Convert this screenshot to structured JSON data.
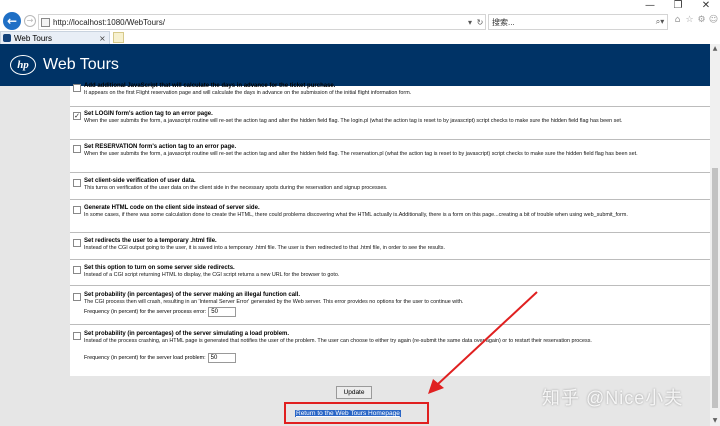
{
  "browser": {
    "url": "http://localhost:1080/WebTours/",
    "search_placeholder": "搜索...",
    "tab_title": "Web Tours",
    "window_controls": [
      "—",
      "❐",
      "✕"
    ]
  },
  "header": {
    "logo_text": "hp",
    "brand": "Web Tours"
  },
  "options": [
    {
      "checked": false,
      "title": "Add additional JavaScript that will calculate the days in advance for the ticket purchase.",
      "desc": "It appears on the first Flight reservation page and will calculate the days in advance on the submission of the initial flight information form."
    },
    {
      "checked": true,
      "title": "Set LOGIN form's action tag to an error page.",
      "desc": "When the user submits the form, a javascript routine will re-set the action tag and alter the hidden field flag. The login.pl (what the action tag is reset to by javascript) script checks to make sure the hidden field flag has been set."
    },
    {
      "checked": false,
      "title": "Set RESERVATION form's action tag to an error page.",
      "desc": "When the user submits the form, a javascript routine will re-set the action tag and alter the hidden field flag. The reservation.pl (what the action tag is reset to by javascript) script checks to make sure the hidden field flag has been set."
    },
    {
      "checked": false,
      "title": "Set client-side verification of user data.",
      "desc": "This turns on verification of the user data on the client side in the necessary spots during the reservation and signup processes."
    },
    {
      "checked": false,
      "title": "Generate HTML code on the client side instead of server side.",
      "desc": "In some cases, if there was some calculation done to create the HTML, there could problems discovering what the HTML actually is.Additionally, there is a form on this page...creating a bit of trouble when using web_submit_form."
    },
    {
      "checked": false,
      "title": "Set redirects the user to a temporary .html file.",
      "desc": "Instead of the CGI output going to the user, it is saved into a temporary .html file. The user is then redirected to that .html file, in order to see the results."
    },
    {
      "checked": false,
      "title": "Set this option to turn on some server side redirects.",
      "desc": "Instead of a CGI script returning HTML to display, the CGI script returns a new URL for the browser to goto."
    },
    {
      "checked": false,
      "title": "Set probability (in percentages) of the server making an illegal function call.",
      "desc": "The CGI process then will crash, resulting in an 'Internal Server Error' generated by the Web server. This error provides no options for the user to continue with.",
      "freq_label": "Frequency (in percent) for the server process error:",
      "freq_value": "50"
    },
    {
      "checked": false,
      "title": "Set probability (in percentages) of the server simulating a load problem.",
      "desc": "Instead of the process crashing, an HTML page is generated that notifies the user of the problem. The user can choose to either try again (re-submit the same data over again) or to restart their reservation process.",
      "freq_label": "Frequency (in percent) for the server load problem:",
      "freq_value": "50"
    }
  ],
  "buttons": {
    "update": "Update"
  },
  "links": {
    "return_home": "Return to the Web Tours Homepage"
  },
  "watermark": "知乎 @Nice小夫",
  "colors": {
    "header_bg": "#003366",
    "highlight_box": "#e02020",
    "link_selected_bg": "#2a66c6"
  }
}
